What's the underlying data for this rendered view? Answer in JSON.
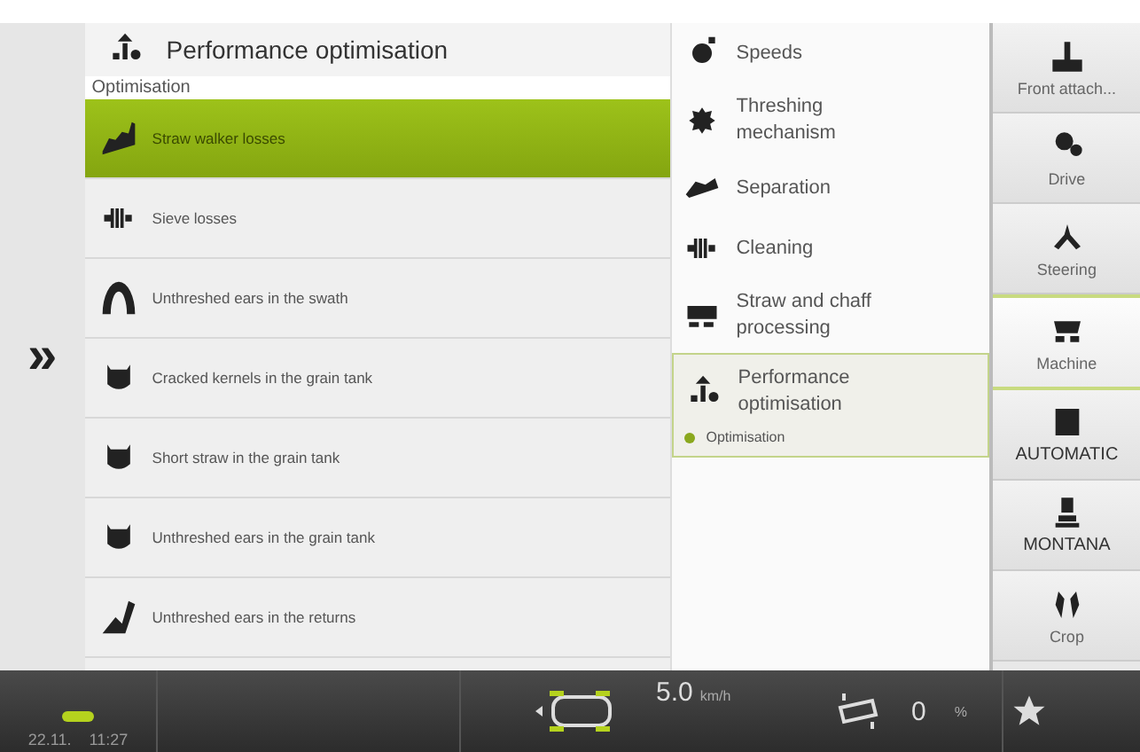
{
  "expand_button": "»",
  "panel": {
    "title": "Performance optimisation",
    "section": "Optimisation",
    "rows": [
      {
        "label": "Straw walker losses",
        "selected": true
      },
      {
        "label": "Sieve losses",
        "selected": false
      },
      {
        "label": "Unthreshed ears in the swath",
        "selected": false
      },
      {
        "label": "Cracked kernels in the grain tank",
        "selected": false
      },
      {
        "label": "Short straw in the grain tank",
        "selected": false
      },
      {
        "label": "Unthreshed ears in the grain tank",
        "selected": false
      },
      {
        "label": "Unthreshed ears in the returns",
        "selected": false
      }
    ]
  },
  "menu": [
    {
      "label": "Speeds",
      "selected": false
    },
    {
      "label": "Threshing mechanism",
      "selected": false
    },
    {
      "label": "Separation",
      "selected": false
    },
    {
      "label": "Cleaning",
      "selected": false
    },
    {
      "label": "Straw and chaff processing",
      "selected": false
    },
    {
      "label": "Performance optimisation",
      "selected": true,
      "sub": "Optimisation"
    }
  ],
  "sidebar": [
    {
      "label": "Front attach...",
      "selected": false
    },
    {
      "label": "Drive",
      "selected": false
    },
    {
      "label": "Steering",
      "selected": false
    },
    {
      "label": "Machine",
      "selected": true
    },
    {
      "label": "AUTOMATIC",
      "selected": false
    },
    {
      "label": "MONTANA",
      "selected": false
    },
    {
      "label": "Crop",
      "selected": false
    }
  ],
  "status_bar": {
    "date": "22.11.",
    "time": "11:27",
    "speed": "5.0",
    "speed_unit": "km/h",
    "slope": "0",
    "slope_unit": "%"
  }
}
